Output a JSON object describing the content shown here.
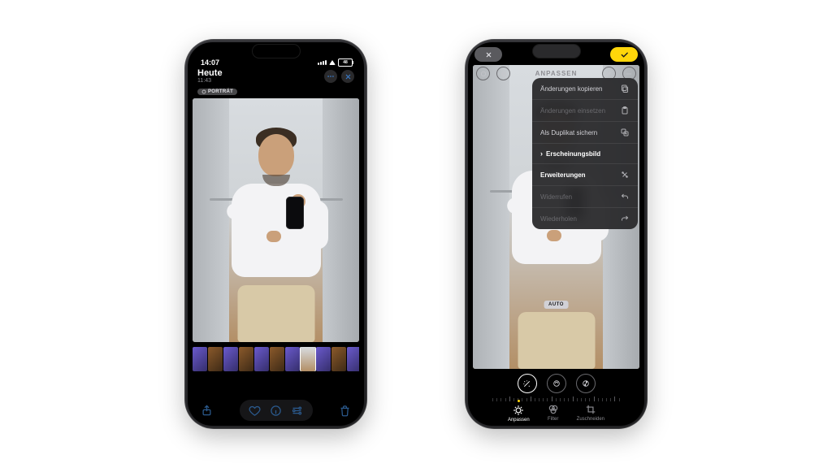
{
  "left": {
    "status": {
      "time": "14:07",
      "battery": "48"
    },
    "header": {
      "title": "Heute",
      "subtitle": "11:43",
      "badge": "PORTRÄT"
    },
    "toolbar": {
      "share": "share-icon",
      "favorite": "heart-icon",
      "info": "info-icon",
      "adjust": "adjust-icon",
      "delete": "trash-icon"
    }
  },
  "right": {
    "header": {
      "title": "ANPASSEN"
    },
    "photo_caption": "AUTO",
    "menu": [
      {
        "label": "Änderungen kopieren",
        "icon": "copy-icon",
        "enabled": true
      },
      {
        "label": "Änderungen einsetzen",
        "icon": "paste-icon",
        "enabled": false
      },
      {
        "label": "Als Duplikat sichern",
        "icon": "duplicate-icon",
        "enabled": true
      },
      {
        "label": "Erscheinungsbild",
        "icon": "chevron-right-icon",
        "enabled": true,
        "strong": true,
        "leading_chevron": true
      },
      {
        "label": "Erweiterungen",
        "icon": "extensions-icon",
        "enabled": true,
        "strong": true
      },
      {
        "label": "Widerrufen",
        "icon": "undo-icon",
        "enabled": false
      },
      {
        "label": "Wiederholen",
        "icon": "redo-icon",
        "enabled": false
      }
    ],
    "tabs": [
      {
        "label": "Anpassen",
        "icon": "adjust-icon",
        "active": true
      },
      {
        "label": "Filter",
        "icon": "filter-icon",
        "active": false
      },
      {
        "label": "Zuschneiden",
        "icon": "crop-icon",
        "active": false
      }
    ]
  }
}
